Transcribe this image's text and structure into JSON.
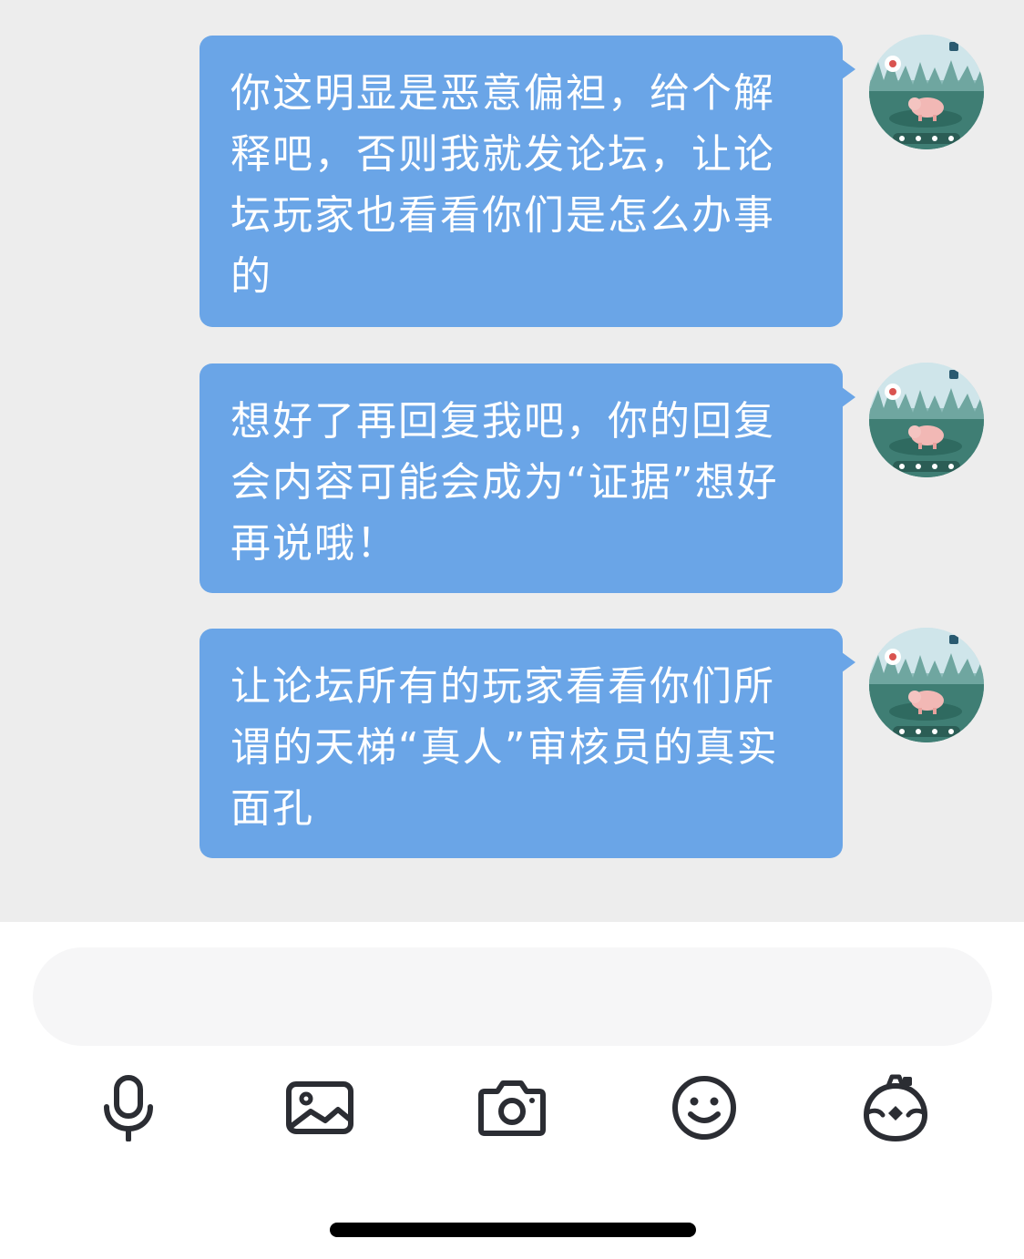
{
  "messages": [
    {
      "text": "你这明显是恶意偏袒，给个解释吧，否则我就发论坛，让论坛玩家也看看你们是怎么办事的",
      "avatar": "pig-game-avatar"
    },
    {
      "text": "想好了再回复我吧，你的回复会内容可能会成为“证据”想好再说哦！",
      "avatar": "pig-game-avatar"
    },
    {
      "text": "让论坛所有的玩家看看你们所谓的天梯“真人”审核员的真实面孔",
      "avatar": "pig-game-avatar"
    }
  ],
  "composer": {
    "input_value": "",
    "tools": [
      "microphone-icon",
      "image-icon",
      "camera-icon",
      "emoji-icon",
      "red-packet-icon"
    ]
  },
  "colors": {
    "chat_background": "#ededed",
    "bubble": "#6aa5e7",
    "bubble_text": "#ffffff",
    "input_background": "#f6f6f7",
    "icon": "#2b2d33"
  }
}
